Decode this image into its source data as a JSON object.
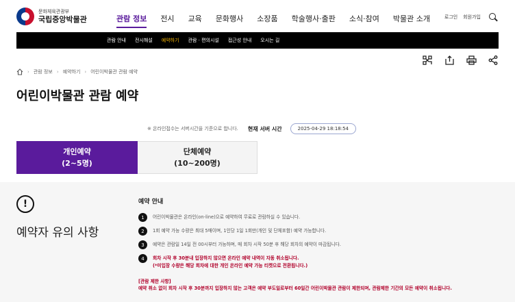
{
  "header": {
    "logo_sub": "문화체육관광부",
    "logo_main": "국립중앙박물관",
    "gnb": [
      "관람 정보",
      "전시",
      "교육",
      "문화행사",
      "소장품",
      "학술행사·출판",
      "소식·참여",
      "박물관 소개"
    ],
    "login": "로그인",
    "signup": "회원가입"
  },
  "subnav": [
    "관람 안내",
    "전시해설",
    "예약하기",
    "관람 · 편의시설",
    "접근성 안내",
    "오시는 길"
  ],
  "breadcrumb": [
    "관람 정보",
    "예약하기",
    "어린이박물관 관람 예약"
  ],
  "page_title": "어린이박물관 관람 예약",
  "server": {
    "note": "※ 온라인접수는 서버시간을 기준으로 합니다.",
    "label": "현재 서버 시간",
    "time": "2025-04-29 18:18:54"
  },
  "tabs": {
    "individual_line1": "개인예약",
    "individual_line2": "(2~5명)",
    "group_line1": "단체예약",
    "group_line2": "(10~200명)"
  },
  "notice": {
    "heading": "예약자 유의 사항",
    "subtitle": "예약 안내",
    "rules": [
      {
        "num": "1",
        "text": "어린이박물관은 온라인(on-line)으로 예약하여 무료로 관람하실 수 있습니다."
      },
      {
        "num": "2",
        "text": "1회 예약 가능 수량은 최대 5매이며, 1인당 1일 1회만(개인 및 단체포함) 예약 가능합니다."
      },
      {
        "num": "3",
        "text": "예약은 관람일 14일 전 00시부터 가능하며, 매 회차 시작 50분 후 해당 회차의 예약이 마감됩니다."
      },
      {
        "num": "4",
        "text_line1": "회차 시작 후 30분내 입장하지 않으면 온라인 예약 내역이 자동 취소됩니다.",
        "text_line2": "(*미입장 수량은 해당 회차에 대한 개인 온라인 예약 가능 티켓으로 전환됩니다.)"
      }
    ],
    "restrict_title": "[관람 제한 사항]",
    "restrict_text": "예약 취소 없이 회차 시작 후 30분까지 입장하지 않는 고객은 예약 부도일로부터 60일간 어린이박물관 관람이 제한되며, 관람제한 기간의 모든 예약이 취소됩니다."
  },
  "colors": {
    "accent": "#5a1b9c",
    "subnav_active": "#f7b500",
    "warning": "#b1002a"
  }
}
